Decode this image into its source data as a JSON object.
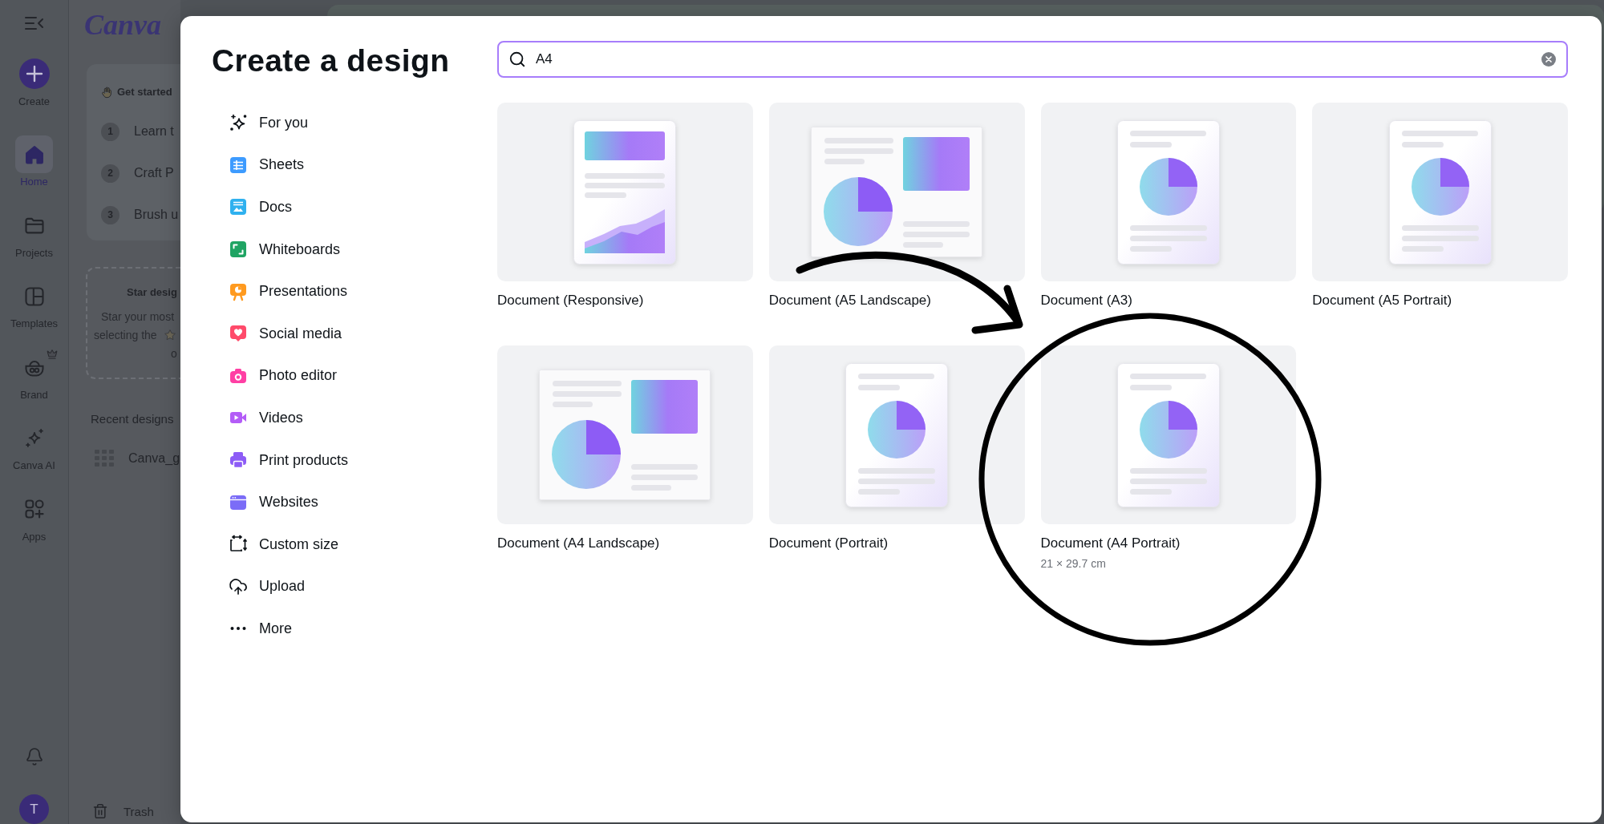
{
  "rail": {
    "create": {
      "label": "Create"
    },
    "items": [
      {
        "label": "Home",
        "selected": true,
        "premium": false
      },
      {
        "label": "Projects",
        "selected": false,
        "premium": false
      },
      {
        "label": "Templates",
        "selected": false,
        "premium": false
      },
      {
        "label": "Brand",
        "selected": false,
        "premium": true
      },
      {
        "label": "Canva AI",
        "selected": false,
        "premium": false
      },
      {
        "label": "Apps",
        "selected": false,
        "premium": false
      }
    ],
    "avatar": "T"
  },
  "home_panel": {
    "logo": "Canva",
    "get_started": {
      "title": "Get started",
      "steps": [
        {
          "number": "1",
          "text": "Learn t"
        },
        {
          "number": "2",
          "text": "Craft P"
        },
        {
          "number": "3",
          "text": "Brush u"
        }
      ]
    },
    "star_card": {
      "title": "Star desig",
      "lines": [
        "Star your most",
        "selecting the",
        "o"
      ]
    },
    "recent": {
      "heading": "Recent designs",
      "items": [
        {
          "name": "Canva_g"
        }
      ]
    },
    "trash": "Trash"
  },
  "dialog": {
    "title": "Create a design",
    "categories": [
      {
        "label": "For you"
      },
      {
        "label": "Sheets"
      },
      {
        "label": "Docs"
      },
      {
        "label": "Whiteboards"
      },
      {
        "label": "Presentations"
      },
      {
        "label": "Social media"
      },
      {
        "label": "Photo editor"
      },
      {
        "label": "Videos"
      },
      {
        "label": "Print products"
      },
      {
        "label": "Websites"
      },
      {
        "label": "Custom size"
      },
      {
        "label": "Upload"
      },
      {
        "label": "More"
      }
    ],
    "search": {
      "value": "A4"
    },
    "results": [
      {
        "name": "Document (Responsive)",
        "kind": "responsive"
      },
      {
        "name": "Document (A5 Landscape)",
        "kind": "landscape"
      },
      {
        "name": "Document (A3)",
        "kind": "portrait"
      },
      {
        "name": "Document (A5 Portrait)",
        "kind": "portrait"
      },
      {
        "name": "Document (A4 Landscape)",
        "kind": "landscape"
      },
      {
        "name": "Document (Portrait)",
        "kind": "portrait"
      },
      {
        "name": "Document (A4 Portrait)",
        "kind": "portrait",
        "size": "21 × 29.7 cm"
      }
    ]
  },
  "markup": [
    {
      "kind": "curved_arrow"
    },
    {
      "kind": "circle"
    }
  ]
}
